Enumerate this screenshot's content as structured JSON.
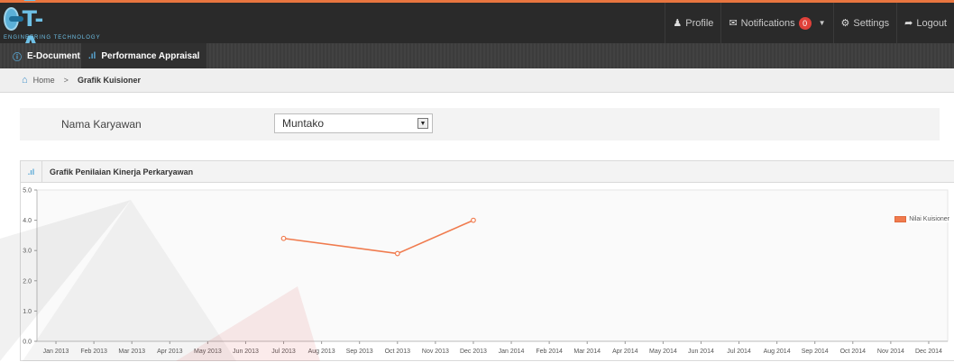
{
  "brand": {
    "logo_text": "E-T-A",
    "tagline": "ENGINEERING TECHNOLOGY"
  },
  "topnav": {
    "profile_label": "Profile",
    "notifications_label": "Notifications",
    "notifications_count": "0",
    "settings_label": "Settings",
    "logout_label": "Logout"
  },
  "modules": [
    {
      "label": "E-Document",
      "icon": "info-circle-icon"
    },
    {
      "label": "Performance Appraisal",
      "icon": "bar-chart-icon"
    }
  ],
  "breadcrumb": {
    "home": "Home",
    "separator": ">",
    "current": "Grafik Kuisioner"
  },
  "filter": {
    "label": "Nama Karyawan",
    "selected": "Muntako"
  },
  "panel": {
    "title": "Grafik Penilaian Kinerja Perkaryawan",
    "icon": "bar-chart-icon"
  },
  "colors": {
    "accent": "#e8753f",
    "series": "#f07b4e",
    "topbar": "#2a2a2a",
    "brand": "#6ec0e6"
  },
  "chart_data": {
    "type": "line",
    "title": "",
    "xlabel": "",
    "ylabel": "",
    "ylim": [
      0,
      5
    ],
    "yticks": [
      "0.0",
      "1.0",
      "2.0",
      "3.0",
      "4.0",
      "5.0"
    ],
    "categories": [
      "Jan 2013",
      "Feb 2013",
      "Mar 2013",
      "Apr 2013",
      "May 2013",
      "Jun 2013",
      "Jul 2013",
      "Aug 2013",
      "Sep 2013",
      "Oct 2013",
      "Nov 2013",
      "Dec 2013",
      "Jan 2014",
      "Feb 2014",
      "Mar 2014",
      "Apr 2014",
      "May 2014",
      "Jun 2014",
      "Jul 2014",
      "Aug 2014",
      "Sep 2014",
      "Oct 2014",
      "Nov 2014",
      "Dec 2014"
    ],
    "series": [
      {
        "name": "Nilai Kuisioner",
        "points": [
          {
            "x": "Jul 2013",
            "y": 3.4
          },
          {
            "x": "Oct 2013",
            "y": 2.9
          },
          {
            "x": "Dec 2013",
            "y": 4.0
          }
        ]
      }
    ],
    "legend": "top-right",
    "grid": false
  }
}
